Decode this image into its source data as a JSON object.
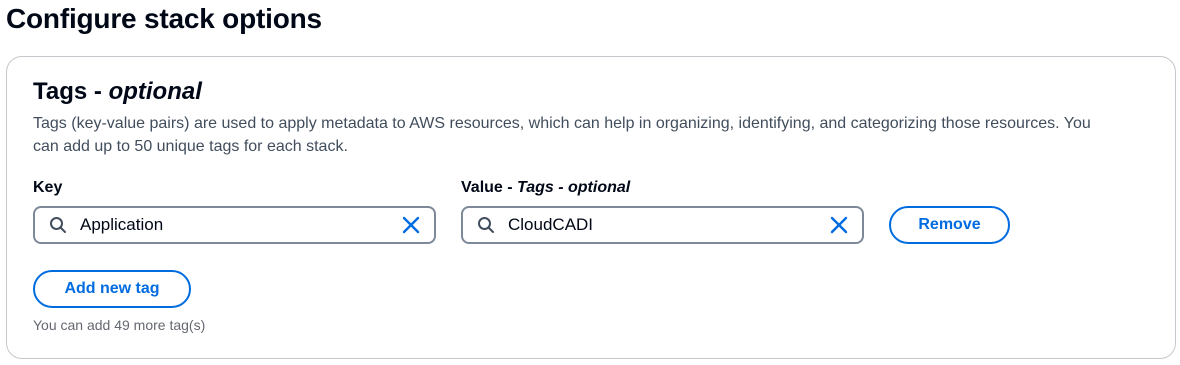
{
  "page": {
    "title": "Configure stack options"
  },
  "tags_section": {
    "title_main": "Tags - ",
    "title_optional": "optional",
    "description": "Tags (key-value pairs) are used to apply metadata to AWS resources, which can help in organizing, identifying, and categorizing those resources. You can add up to 50 unique tags for each stack.",
    "key_label": "Key",
    "value_label_main": "Value - ",
    "value_label_optional": "Tags - optional",
    "tags": [
      {
        "key": "Application",
        "value": "CloudCADI"
      }
    ],
    "remove_label": "Remove",
    "add_label": "Add new tag",
    "hint": "You can add 49 more tag(s)"
  },
  "icons": {
    "search": "search-icon",
    "clear": "close-icon"
  },
  "colors": {
    "accent": "#006ce0",
    "input_border": "#7d8998",
    "container_border": "#c6c6cd",
    "hint_text": "#656871"
  }
}
